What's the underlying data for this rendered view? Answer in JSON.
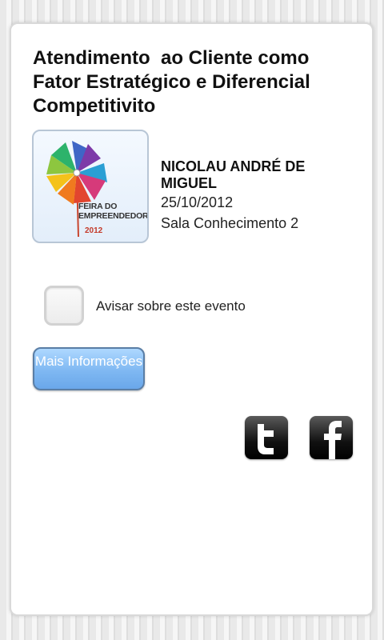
{
  "event": {
    "title": "Atendimento  ao Cliente como Fator Estratégico e Diferencial Competitivito",
    "speaker": "NICOLAU ANDRÉ DE MIGUEL",
    "date": "25/10/2012",
    "room": "Sala Conhecimento 2"
  },
  "logo": {
    "text": "FEIRA DO\nEMPREENDEDOR",
    "year": "2012",
    "icon": "pinwheel-icon"
  },
  "reminder": {
    "label": "Avisar sobre este evento",
    "checked": false
  },
  "more_button": {
    "label": "Mais Informações"
  },
  "social": {
    "twitter_icon": "twitter-icon",
    "facebook_icon": "facebook-icon"
  },
  "colors": {
    "button_blue": "#7fb8f2",
    "button_border": "#5a7ea6",
    "social_bg": "#111111"
  }
}
